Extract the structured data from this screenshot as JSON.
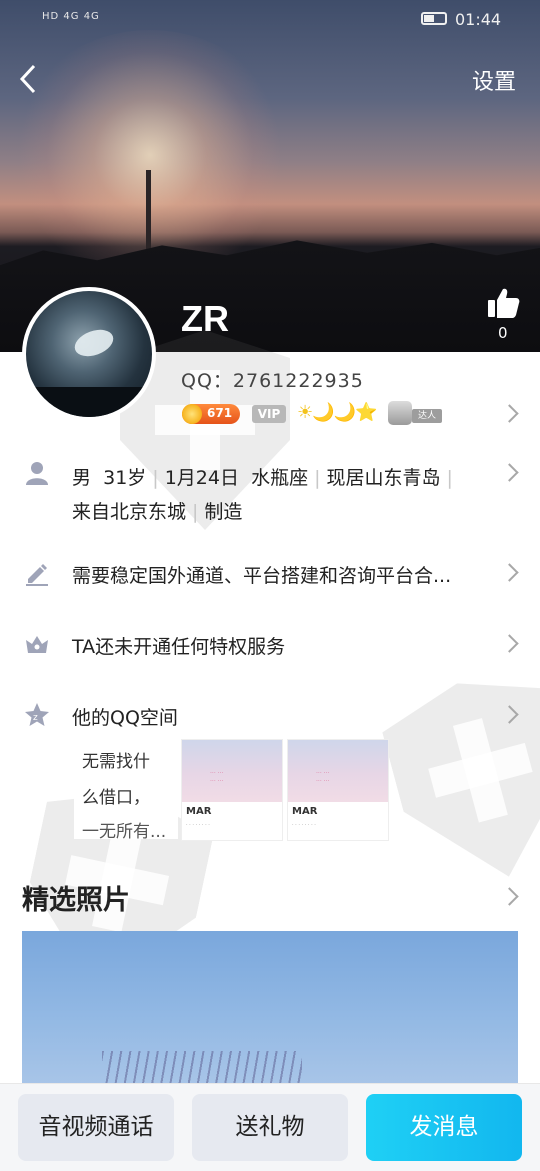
{
  "status_bar": {
    "left_indicators": "HD  4G  4G",
    "time": "01:44"
  },
  "header": {
    "settings_label": "设置",
    "nickname": "ZR",
    "like_count": "0",
    "qq_number": "QQ：2761222935"
  },
  "badges": {
    "coin_value": "671",
    "vip_label": "VIP",
    "level_icons": "☀🌙🌙⭐",
    "daren_label": "达人"
  },
  "profile_info": {
    "gender": "男",
    "age": "31岁",
    "birthday": "1月24日",
    "zodiac": "水瓶座",
    "residence": "现居山东青岛",
    "hometown": "来自北京东城",
    "occupation": "制造"
  },
  "signature": "需要稳定国外通道、平台搭建和咨询平台合...",
  "privilege": "TA还未开通任何特权服务",
  "qzone": {
    "title": "他的QQ空间",
    "post_text_lines": [
      "无需找什",
      "么借口，",
      "一无所有..."
    ],
    "thumb_label": "MAR"
  },
  "photos": {
    "title": "精选照片"
  },
  "actions": {
    "call": "音视频通话",
    "gift": "送礼物",
    "message": "发消息"
  },
  "colors": {
    "message_button": "#12b7ef",
    "secondary_button": "#e6e9f0"
  }
}
